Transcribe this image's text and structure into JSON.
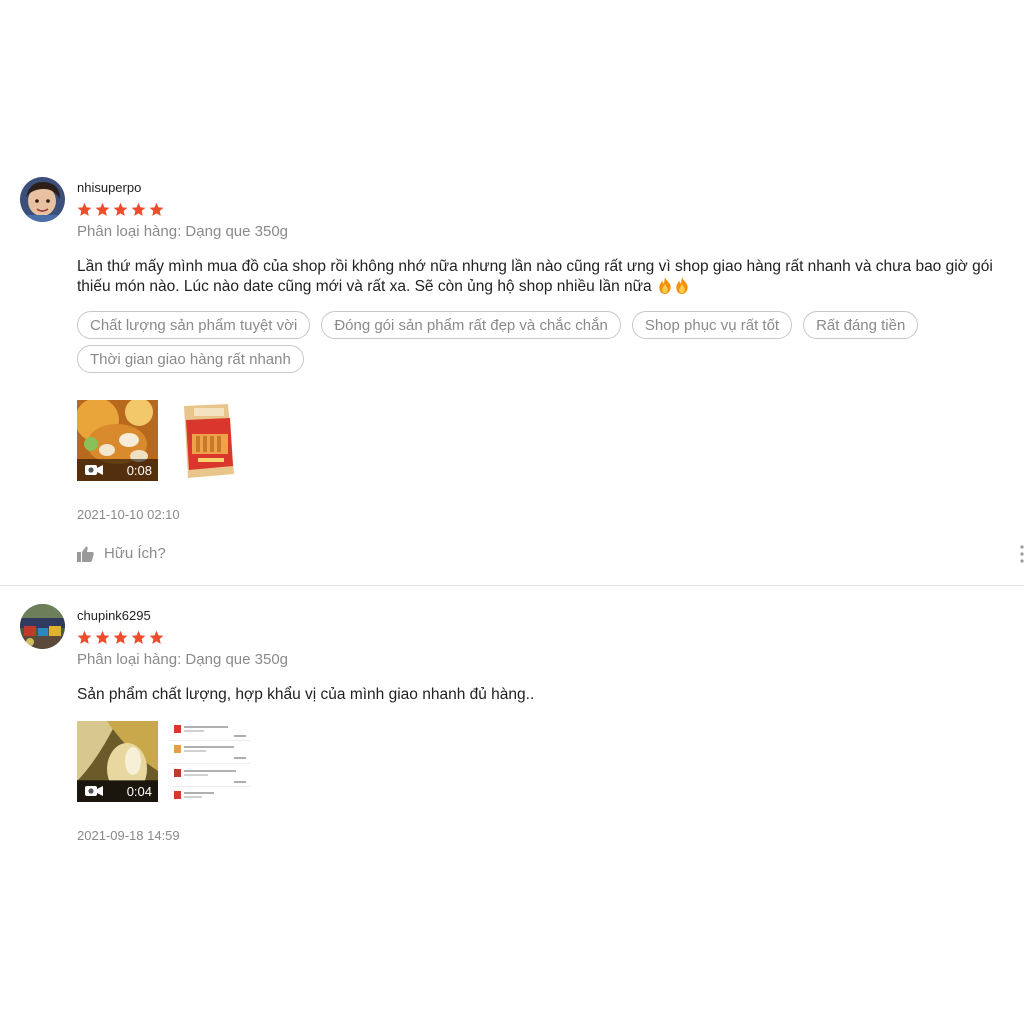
{
  "reviews": [
    {
      "username": "nhisuperpo",
      "rating": 5,
      "variant": "Phân loại hàng: Dạng que 350g",
      "comment": "Lần thứ mấy mình mua đồ của shop rồi không nhớ nữa nhưng lần nào cũng rất ưng vì shop giao hàng rất nhanh và chưa bao giờ gói thiếu món nào. Lúc nào date cũng mới và rất xa. Sẽ còn ủng hộ shop nhiều lần nữa ",
      "tags": [
        "Chất lượng sản phẩm tuyệt vời",
        "Đóng gói sản phẩm rất đẹp và chắc chắn",
        "Shop phục vụ rất tốt",
        "Rất đáng tiền",
        "Thời gian giao hàng rất nhanh"
      ],
      "video_duration": "0:08",
      "timestamp": "2021-10-10 02:10",
      "helpful_label": "Hữu Ích?"
    },
    {
      "username": "chupink6295",
      "rating": 5,
      "variant": "Phân loại hàng: Dạng que 350g",
      "comment": "Sản phẩm chất lượng, hợp khẩu vị của mình giao nhanh đủ hàng..",
      "video_duration": "0:04",
      "timestamp": "2021-09-18 14:59"
    }
  ],
  "colors": {
    "star": "#ee4d2d",
    "muted_text": "#8a8a8a",
    "tag_border": "#c8c8c8"
  },
  "icons": {
    "star": "star-icon",
    "video": "video-camera-icon",
    "like": "thumbs-up-icon",
    "more": "more-vertical-icon",
    "fire": "fire-emoji"
  }
}
